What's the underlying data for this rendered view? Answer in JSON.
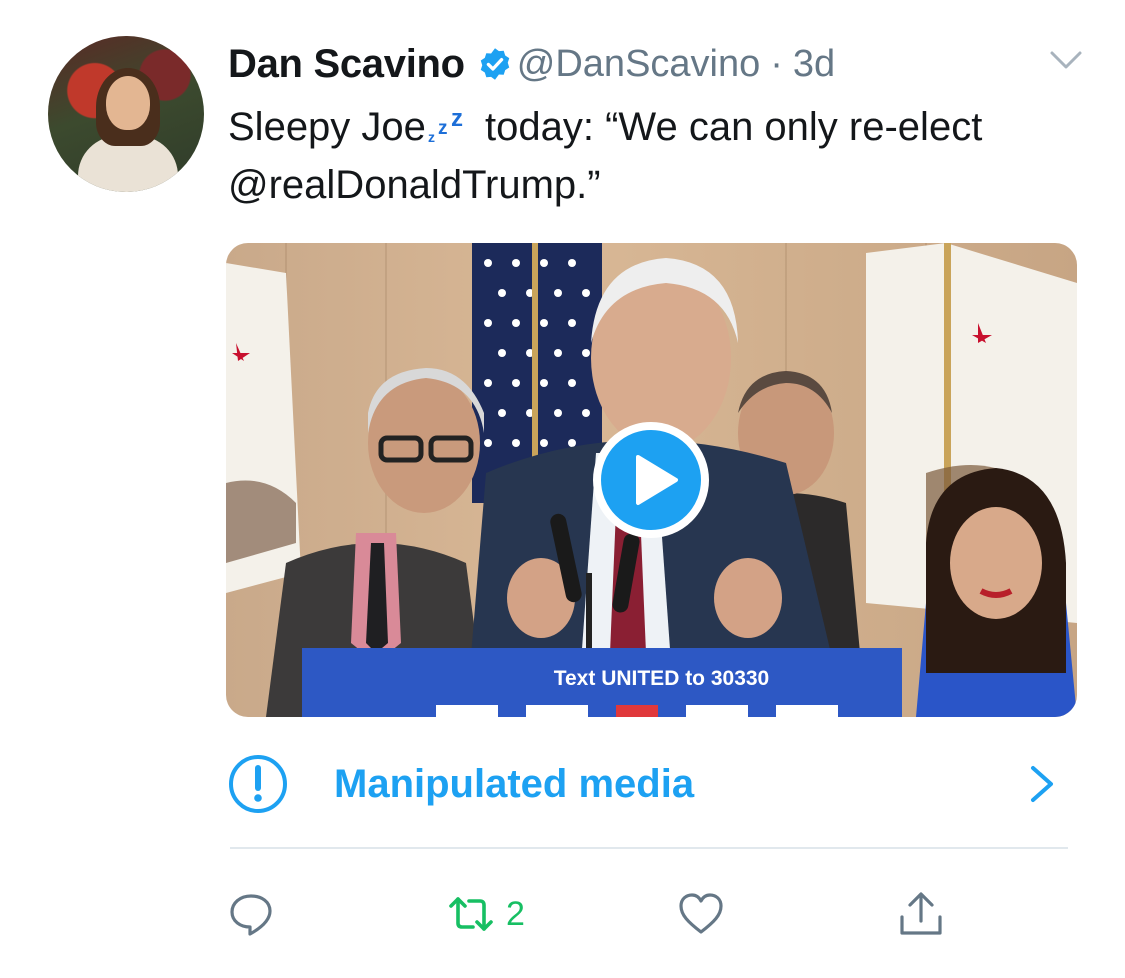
{
  "author": {
    "name": "Dan Scavino",
    "handle": "@DanScavino",
    "separator": "·",
    "time": "3d",
    "verified": true,
    "avatar_icon": "user-avatar"
  },
  "tweet": {
    "text_before_emoji": "Sleepy Joe",
    "emoji": "sleeping-zzz-emoji",
    "text_after_emoji": " today: “We can only re-elect @realDonaldTrump.”"
  },
  "media": {
    "type": "video",
    "banner_text": "Text UNITED to 30330",
    "play_icon": "play-icon"
  },
  "notice": {
    "label": "Manipulated media",
    "icon": "exclamation-circle-icon",
    "color": "#1da1f2"
  },
  "actions": {
    "reply": {
      "icon": "reply-icon",
      "count": ""
    },
    "retweet": {
      "icon": "retweet-icon",
      "count": "2",
      "color": "#17bf63"
    },
    "like": {
      "icon": "heart-icon",
      "count": ""
    },
    "share": {
      "icon": "share-icon",
      "count": ""
    }
  },
  "colors": {
    "accent": "#1da1f2",
    "secondary_text": "#657786",
    "retweet_active": "#17bf63"
  }
}
